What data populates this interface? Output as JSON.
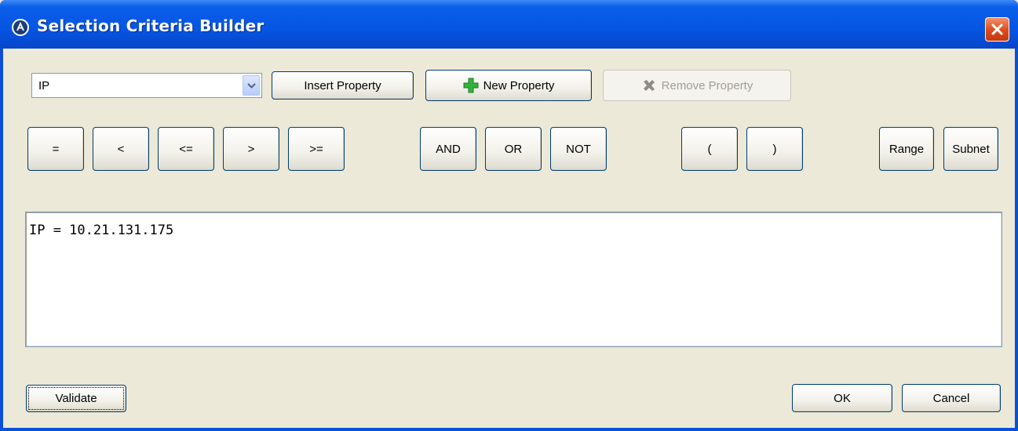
{
  "window": {
    "title": "Selection Criteria Builder",
    "icon": "circle-a-icon",
    "close_icon": "close-icon"
  },
  "toolbar": {
    "property_select": {
      "value": "IP"
    },
    "insert_property_label": "Insert Property",
    "new_property_label": "New Property",
    "new_property_icon": "plus-icon",
    "remove_property_label": "Remove Property",
    "remove_property_icon": "x-icon"
  },
  "operators": {
    "eq": "=",
    "lt": "<",
    "le": "<=",
    "gt": ">",
    ">=": ">=",
    "and": "AND",
    "or": "OR",
    "not": "NOT",
    "lparen": "(",
    "rparen": ")",
    "range": "Range",
    "subnet": "Subnet"
  },
  "editor": {
    "value": "IP = 10.21.131.175"
  },
  "footer": {
    "validate_label": "Validate",
    "ok_label": "OK",
    "cancel_label": "Cancel"
  },
  "colors": {
    "titlebar": "#0655e3",
    "window_bg": "#ece9d8",
    "close_button": "#dd4a1b",
    "plus_icon": "#2fa83a",
    "disabled_text": "#a19f93"
  }
}
